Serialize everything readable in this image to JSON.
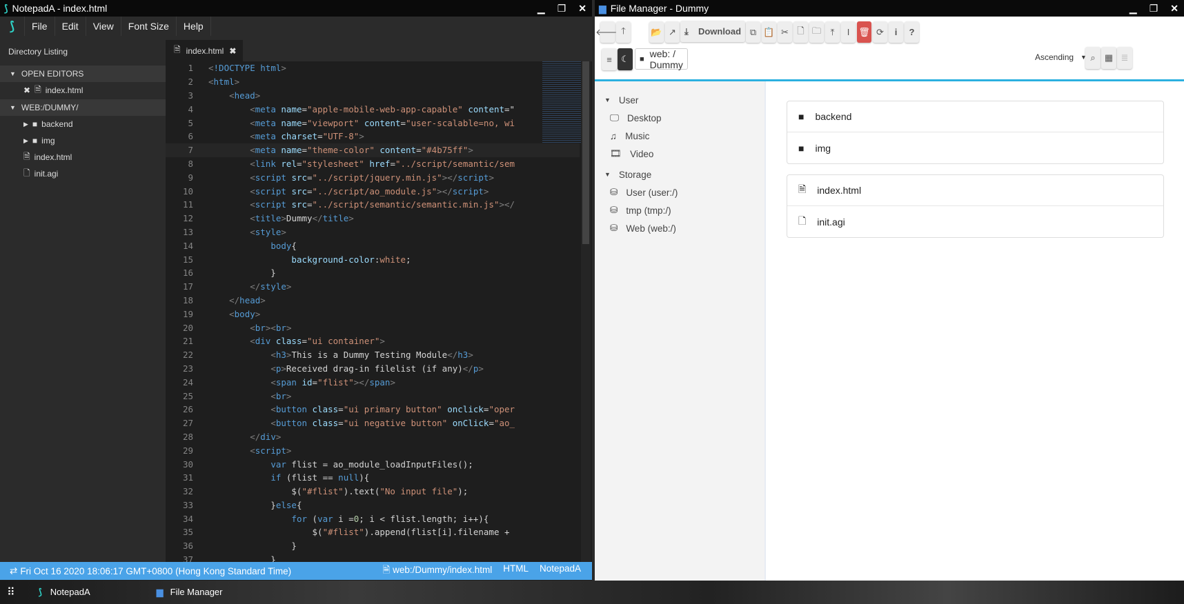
{
  "notepad": {
    "title": "NotepadA - index.html",
    "menu": [
      "File",
      "Edit",
      "View",
      "Font Size",
      "Help"
    ],
    "sidebar": {
      "heading": "Directory Listing",
      "open_editors": "OPEN EDITORS",
      "open_file": "index.html",
      "folder": "WEB:/DUMMY/",
      "items": [
        {
          "name": "backend",
          "type": "folder"
        },
        {
          "name": "img",
          "type": "folder"
        },
        {
          "name": "index.html",
          "type": "html"
        },
        {
          "name": "init.agi",
          "type": "file"
        }
      ]
    },
    "tab": "index.html",
    "code": [
      [
        [
          "p",
          "<"
        ],
        [
          "t",
          "!DOCTYPE html"
        ],
        [
          "p",
          ">"
        ]
      ],
      [
        [
          "p",
          "<"
        ],
        [
          "t",
          "html"
        ],
        [
          "p",
          ">"
        ]
      ],
      [
        [
          "x",
          "    "
        ],
        [
          "p",
          "<"
        ],
        [
          "t",
          "head"
        ],
        [
          "p",
          ">"
        ]
      ],
      [
        [
          "x",
          "        "
        ],
        [
          "p",
          "<"
        ],
        [
          "t",
          "meta "
        ],
        [
          "a",
          "name"
        ],
        [
          "x",
          "="
        ],
        [
          "s",
          "\"apple-mobile-web-app-capable\""
        ],
        [
          "a",
          " content"
        ],
        [
          "x",
          "=\""
        ]
      ],
      [
        [
          "x",
          "        "
        ],
        [
          "p",
          "<"
        ],
        [
          "t",
          "meta "
        ],
        [
          "a",
          "name"
        ],
        [
          "x",
          "="
        ],
        [
          "s",
          "\"viewport\""
        ],
        [
          "a",
          " content"
        ],
        [
          "x",
          "="
        ],
        [
          "s",
          "\"user-scalable=no, wi"
        ]
      ],
      [
        [
          "x",
          "        "
        ],
        [
          "p",
          "<"
        ],
        [
          "t",
          "meta "
        ],
        [
          "a",
          "charset"
        ],
        [
          "x",
          "="
        ],
        [
          "s",
          "\"UTF-8\""
        ],
        [
          "p",
          ">"
        ]
      ],
      [
        [
          "x",
          "        "
        ],
        [
          "p",
          "<"
        ],
        [
          "t",
          "meta "
        ],
        [
          "a",
          "name"
        ],
        [
          "x",
          "="
        ],
        [
          "s",
          "\"theme-color\""
        ],
        [
          "a",
          " content"
        ],
        [
          "x",
          "="
        ],
        [
          "s",
          "\"#4b75ff\""
        ],
        [
          "p",
          ">"
        ]
      ],
      [
        [
          "x",
          "        "
        ],
        [
          "p",
          "<"
        ],
        [
          "t",
          "link "
        ],
        [
          "a",
          "rel"
        ],
        [
          "x",
          "="
        ],
        [
          "s",
          "\"stylesheet\""
        ],
        [
          "a",
          " href"
        ],
        [
          "x",
          "="
        ],
        [
          "s",
          "\"../script/semantic/sem"
        ]
      ],
      [
        [
          "x",
          "        "
        ],
        [
          "p",
          "<"
        ],
        [
          "t",
          "script "
        ],
        [
          "a",
          "src"
        ],
        [
          "x",
          "="
        ],
        [
          "s",
          "\"../script/jquery.min.js\""
        ],
        [
          "p",
          "></"
        ],
        [
          "t",
          "script"
        ],
        [
          "p",
          ">"
        ]
      ],
      [
        [
          "x",
          "        "
        ],
        [
          "p",
          "<"
        ],
        [
          "t",
          "script "
        ],
        [
          "a",
          "src"
        ],
        [
          "x",
          "="
        ],
        [
          "s",
          "\"../script/ao_module.js\""
        ],
        [
          "p",
          "></"
        ],
        [
          "t",
          "script"
        ],
        [
          "p",
          ">"
        ]
      ],
      [
        [
          "x",
          "        "
        ],
        [
          "p",
          "<"
        ],
        [
          "t",
          "script "
        ],
        [
          "a",
          "src"
        ],
        [
          "x",
          "="
        ],
        [
          "s",
          "\"../script/semantic/semantic.min.js\""
        ],
        [
          "p",
          "></"
        ]
      ],
      [
        [
          "x",
          "        "
        ],
        [
          "p",
          "<"
        ],
        [
          "t",
          "title"
        ],
        [
          "p",
          ">"
        ],
        [
          "x",
          "Dummy"
        ],
        [
          "p",
          "</"
        ],
        [
          "t",
          "title"
        ],
        [
          "p",
          ">"
        ]
      ],
      [
        [
          "x",
          "        "
        ],
        [
          "p",
          "<"
        ],
        [
          "t",
          "style"
        ],
        [
          "p",
          ">"
        ]
      ],
      [
        [
          "x",
          "            "
        ],
        [
          "t",
          "body"
        ],
        [
          "x",
          "{"
        ]
      ],
      [
        [
          "x",
          "                "
        ],
        [
          "a",
          "background-color"
        ],
        [
          "x",
          ":"
        ],
        [
          "s",
          "white"
        ],
        [
          "x",
          ";"
        ]
      ],
      [
        [
          "x",
          "            }"
        ]
      ],
      [
        [
          "x",
          "        "
        ],
        [
          "p",
          "</"
        ],
        [
          "t",
          "style"
        ],
        [
          "p",
          ">"
        ]
      ],
      [
        [
          "x",
          "    "
        ],
        [
          "p",
          "</"
        ],
        [
          "t",
          "head"
        ],
        [
          "p",
          ">"
        ]
      ],
      [
        [
          "x",
          "    "
        ],
        [
          "p",
          "<"
        ],
        [
          "t",
          "body"
        ],
        [
          "p",
          ">"
        ]
      ],
      [
        [
          "x",
          "        "
        ],
        [
          "p",
          "<"
        ],
        [
          "t",
          "br"
        ],
        [
          "p",
          "><"
        ],
        [
          "t",
          "br"
        ],
        [
          "p",
          ">"
        ]
      ],
      [
        [
          "x",
          "        "
        ],
        [
          "p",
          "<"
        ],
        [
          "t",
          "div "
        ],
        [
          "a",
          "class"
        ],
        [
          "x",
          "="
        ],
        [
          "s",
          "\"ui container\""
        ],
        [
          "p",
          ">"
        ]
      ],
      [
        [
          "x",
          "            "
        ],
        [
          "p",
          "<"
        ],
        [
          "t",
          "h3"
        ],
        [
          "p",
          ">"
        ],
        [
          "x",
          "This is a Dummy Testing Module"
        ],
        [
          "p",
          "</"
        ],
        [
          "t",
          "h3"
        ],
        [
          "p",
          ">"
        ]
      ],
      [
        [
          "x",
          "            "
        ],
        [
          "p",
          "<"
        ],
        [
          "t",
          "p"
        ],
        [
          "p",
          ">"
        ],
        [
          "x",
          "Received drag-in filelist (if any)"
        ],
        [
          "p",
          "</"
        ],
        [
          "t",
          "p"
        ],
        [
          "p",
          ">"
        ]
      ],
      [
        [
          "x",
          "            "
        ],
        [
          "p",
          "<"
        ],
        [
          "t",
          "span "
        ],
        [
          "a",
          "id"
        ],
        [
          "x",
          "="
        ],
        [
          "s",
          "\"flist\""
        ],
        [
          "p",
          "></"
        ],
        [
          "t",
          "span"
        ],
        [
          "p",
          ">"
        ]
      ],
      [
        [
          "x",
          "            "
        ],
        [
          "p",
          "<"
        ],
        [
          "t",
          "br"
        ],
        [
          "p",
          ">"
        ]
      ],
      [
        [
          "x",
          "            "
        ],
        [
          "p",
          "<"
        ],
        [
          "t",
          "button "
        ],
        [
          "a",
          "class"
        ],
        [
          "x",
          "="
        ],
        [
          "s",
          "\"ui primary button\""
        ],
        [
          "a",
          " onclick"
        ],
        [
          "x",
          "="
        ],
        [
          "s",
          "\"oper"
        ]
      ],
      [
        [
          "x",
          "            "
        ],
        [
          "p",
          "<"
        ],
        [
          "t",
          "button "
        ],
        [
          "a",
          "class"
        ],
        [
          "x",
          "="
        ],
        [
          "s",
          "\"ui negative button\""
        ],
        [
          "a",
          " onClick"
        ],
        [
          "x",
          "="
        ],
        [
          "s",
          "\"ao_"
        ]
      ],
      [
        [
          "x",
          "        "
        ],
        [
          "p",
          "</"
        ],
        [
          "t",
          "div"
        ],
        [
          "p",
          ">"
        ]
      ],
      [
        [
          "x",
          "        "
        ],
        [
          "p",
          "<"
        ],
        [
          "t",
          "script"
        ],
        [
          "p",
          ">"
        ]
      ],
      [
        [
          "x",
          "            "
        ],
        [
          "k",
          "var"
        ],
        [
          "x",
          " flist = ao_module_loadInputFiles();"
        ]
      ],
      [
        [
          "x",
          "            "
        ],
        [
          "k",
          "if"
        ],
        [
          "x",
          " (flist == "
        ],
        [
          "k",
          "null"
        ],
        [
          "x",
          "){"
        ]
      ],
      [
        [
          "x",
          "                $("
        ],
        [
          "s",
          "\"#flist\""
        ],
        [
          "x",
          ").text("
        ],
        [
          "s",
          "\"No input file\""
        ],
        [
          "x",
          ");"
        ]
      ],
      [
        [
          "x",
          "            }"
        ],
        [
          "k",
          "else"
        ],
        [
          "x",
          "{"
        ]
      ],
      [
        [
          "x",
          "                "
        ],
        [
          "k",
          "for"
        ],
        [
          "x",
          " ("
        ],
        [
          "k",
          "var"
        ],
        [
          "x",
          " i ="
        ],
        [
          "n",
          "0"
        ],
        [
          "x",
          "; i < flist.length; i++){"
        ]
      ],
      [
        [
          "x",
          "                    $("
        ],
        [
          "s",
          "\"#flist\""
        ],
        [
          "x",
          ").append(flist[i].filename +"
        ]
      ],
      [
        [
          "x",
          "                }"
        ]
      ],
      [
        [
          "x",
          "            }"
        ]
      ],
      [
        [
          "x",
          ""
        ]
      ],
      [
        [
          "x",
          ""
        ]
      ]
    ],
    "status": {
      "datetime": "Fri Oct 16 2020 18:06:17 GMT+0800 (Hong Kong Standard Time)",
      "path": "web:/Dummy/index.html",
      "lang": "HTML",
      "app": "NotepadA"
    },
    "accent": "#4aa3e8"
  },
  "filemanager": {
    "title": "File Manager - Dummy",
    "download": "Download",
    "path": "web: / Dummy",
    "sort": "Ascending",
    "sidebar": {
      "user": "User",
      "user_items": [
        {
          "label": "Desktop",
          "icon": "desktop-icon"
        },
        {
          "label": "Music",
          "icon": "music-icon"
        },
        {
          "label": "Video",
          "icon": "film-icon"
        }
      ],
      "storage": "Storage",
      "storage_items": [
        "User (user:/)",
        "tmp (tmp:/)",
        "Web (web:/)"
      ]
    },
    "folders": [
      "backend",
      "img"
    ],
    "files": [
      {
        "name": "index.html",
        "icon": "html-file-icon"
      },
      {
        "name": "init.agi",
        "icon": "file-icon"
      }
    ],
    "delete_color": "#d9534f"
  },
  "taskbar": {
    "items": [
      "NotepadA",
      "File Manager"
    ]
  }
}
